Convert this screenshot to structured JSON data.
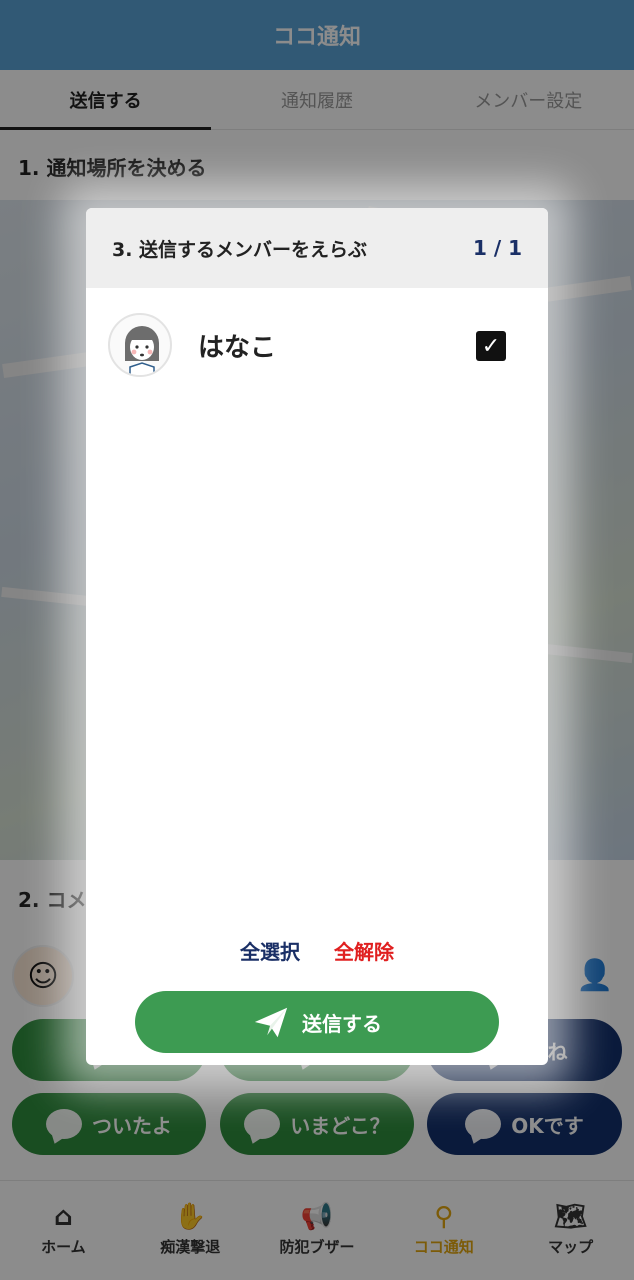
{
  "app": {
    "title": "ココ通知",
    "tabs": [
      {
        "label": "送信する",
        "active": true
      },
      {
        "label": "通知履歴",
        "active": false
      },
      {
        "label": "メンバー設定",
        "active": false
      }
    ],
    "section1_title": "1. 通知場所を決める",
    "section2_title": "2. コメ",
    "quick_messages": [
      {
        "label": "",
        "color": "green"
      },
      {
        "label": "",
        "color": "green"
      },
      {
        "label": "いね",
        "color": "navy"
      },
      {
        "label": "ついたよ",
        "color": "green"
      },
      {
        "label": "いまどこ？",
        "color": "green"
      },
      {
        "label": "OKです",
        "color": "navy"
      }
    ]
  },
  "bottom_nav": [
    {
      "label": "ホーム",
      "icon": "home-icon",
      "active": false
    },
    {
      "label": "痴漢撃退",
      "icon": "hand-stop-icon",
      "active": false
    },
    {
      "label": "防犯ブザー",
      "icon": "megaphone-icon",
      "active": false
    },
    {
      "label": "ココ通知",
      "icon": "location-pin-icon",
      "active": true
    },
    {
      "label": "マップ",
      "icon": "map-icon",
      "active": false
    }
  ],
  "modal": {
    "title": "3. 送信するメンバーをえらぶ",
    "page": "1 / 1",
    "members": [
      {
        "name": "はなこ",
        "checked": true
      }
    ],
    "select_all_label": "全選択",
    "deselect_all_label": "全解除",
    "send_label": "送信する"
  },
  "colors": {
    "header": "#5aa3d6",
    "green": "#3d9b52",
    "navy": "#1a2f66",
    "red": "#e02020",
    "nav_active": "#e2a610"
  }
}
